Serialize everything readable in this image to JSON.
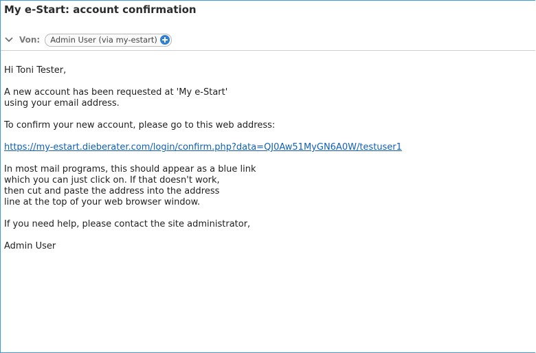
{
  "email": {
    "subject": "My e-Start: account confirmation",
    "from_label": "Von:",
    "sender": "Admin User (via my-estart)",
    "icons": {
      "expand": "chevron-down-icon",
      "add_contact": "plus-circle-icon"
    },
    "body": {
      "greeting": "Hi Toni Tester,",
      "para1": [
        "A new account has been requested at 'My e-Start'",
        "using your email address."
      ],
      "para2": "To confirm your new account, please go to this web address:",
      "link": "https://my-estart.dieberater.com/login/confirm.php?data=QJ0Aw51MyGN6A0W/testuser1",
      "para3": [
        "In most mail programs, this should appear as a blue link",
        "which you can just click on. If that doesn't work,",
        "then cut and paste the address into the address",
        "line at the top of your web browser window."
      ],
      "para4": "If you need help, please contact the site administrator,",
      "signature": "Admin User"
    }
  },
  "colors": {
    "frame_border": "#3d9bd8",
    "link": "#0f5fb8",
    "plus_icon": "#2f7fd6"
  }
}
